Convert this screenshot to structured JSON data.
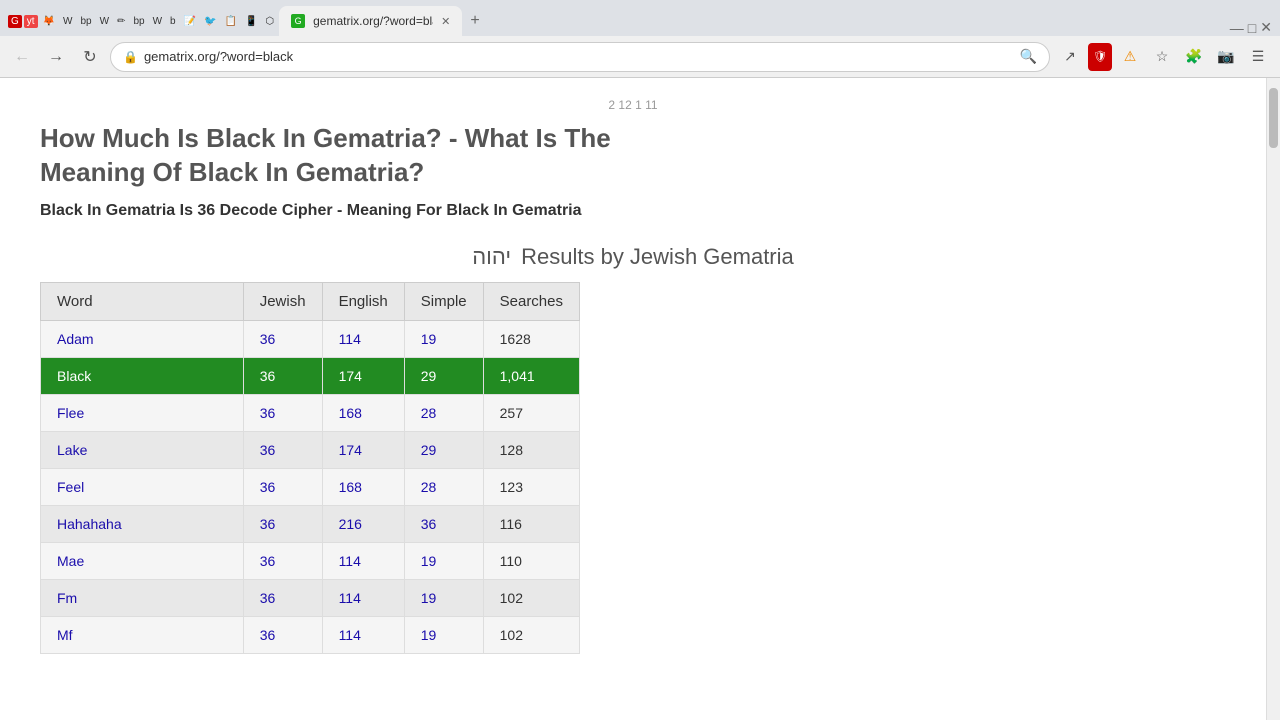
{
  "browser": {
    "tab_title": "gematrix.org/?word=black",
    "url": "gematrix.org/?word=black",
    "favicon": "G"
  },
  "page": {
    "partial_header": "2 12 1 11",
    "heading": "How Much Is Black In Gematria? - What Is The Meaning Of Black In Gematria?",
    "subtitle": "Black In Gematria Is 36 Decode Cipher - Meaning For Black In Gematria",
    "table_title": "Results by Jewish Gematria",
    "hebrew_symbol": "יהוה",
    "columns": [
      "Word",
      "Jewish",
      "English",
      "Simple",
      "Searches"
    ],
    "rows": [
      {
        "word": "Adam",
        "jewish": "36",
        "english": "114",
        "simple": "19",
        "searches": "1628",
        "highlight": false
      },
      {
        "word": "Black",
        "jewish": "36",
        "english": "174",
        "simple": "29",
        "searches": "1,041",
        "highlight": true
      },
      {
        "word": "Flee",
        "jewish": "36",
        "english": "168",
        "simple": "28",
        "searches": "257",
        "highlight": false
      },
      {
        "word": "Lake",
        "jewish": "36",
        "english": "174",
        "simple": "29",
        "searches": "128",
        "highlight": false
      },
      {
        "word": "Feel",
        "jewish": "36",
        "english": "168",
        "simple": "28",
        "searches": "123",
        "highlight": false
      },
      {
        "word": "Hahahaha",
        "jewish": "36",
        "english": "216",
        "simple": "36",
        "searches": "116",
        "highlight": false
      },
      {
        "word": "Mae",
        "jewish": "36",
        "english": "114",
        "simple": "19",
        "searches": "110",
        "highlight": false
      },
      {
        "word": "Fm",
        "jewish": "36",
        "english": "114",
        "simple": "19",
        "searches": "102",
        "highlight": false
      },
      {
        "word": "Mf",
        "jewish": "36",
        "english": "114",
        "simple": "19",
        "searches": "102",
        "highlight": false
      }
    ]
  }
}
